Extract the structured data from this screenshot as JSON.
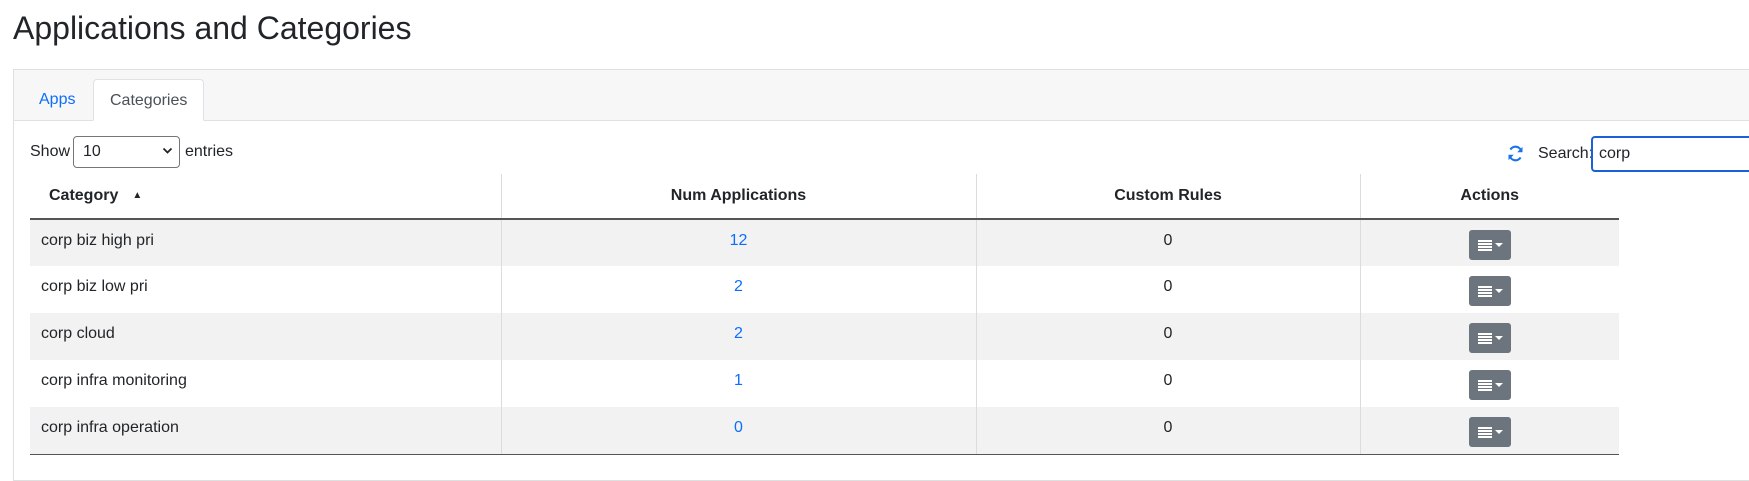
{
  "page": {
    "title": "Applications and Categories"
  },
  "tabs": [
    {
      "label": "Apps",
      "active": false
    },
    {
      "label": "Categories",
      "active": true
    }
  ],
  "controls": {
    "show_label": "Show",
    "page_size": "10",
    "entries_label": "entries",
    "search_label": "Search:",
    "search_value": "corp",
    "refresh_icon": "refresh-icon"
  },
  "table": {
    "columns": [
      "Category",
      "Num Applications",
      "Custom Rules",
      "Actions"
    ],
    "sort": {
      "column": "Category",
      "direction": "ascending"
    },
    "rows": [
      {
        "category": "corp biz high pri",
        "num_applications": "12",
        "custom_rules": "0"
      },
      {
        "category": "corp biz low pri",
        "num_applications": "2",
        "custom_rules": "0"
      },
      {
        "category": "corp cloud",
        "num_applications": "2",
        "custom_rules": "0"
      },
      {
        "category": "corp infra monitoring",
        "num_applications": "1",
        "custom_rules": "0"
      },
      {
        "category": "corp infra operation",
        "num_applications": "0",
        "custom_rules": "0"
      }
    ]
  },
  "colors": {
    "link": "#0d6efd",
    "action_button": "#6c757d",
    "stripe": "#f2f2f2",
    "search_focus": "#1d5fd6"
  }
}
